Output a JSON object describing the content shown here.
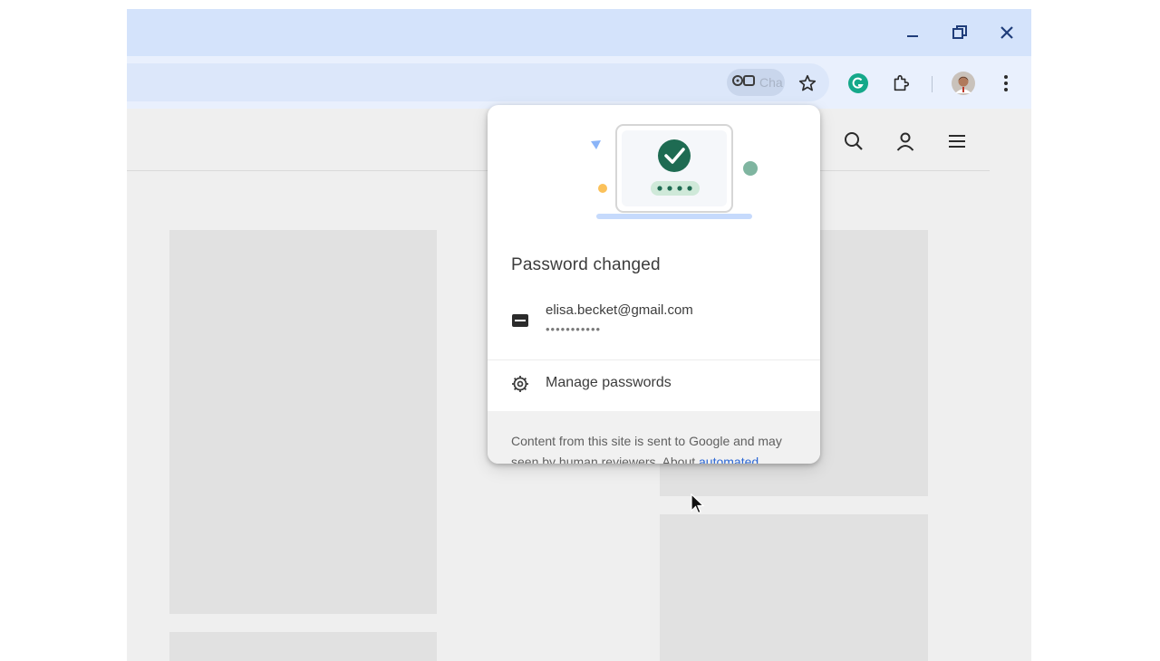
{
  "window": {
    "titlebar_color": "#d4e3fb",
    "controls": [
      {
        "name": "minimize-icon"
      },
      {
        "name": "restore-icon"
      },
      {
        "name": "close-icon"
      }
    ]
  },
  "toolbar": {
    "password_chip": {
      "icon": "key-icon",
      "label": "Cha"
    },
    "icons": [
      "bookmark-star-icon",
      "grammarly-extension-icon",
      "extensions-puzzle-icon",
      "profile-avatar",
      "more-menu-icon"
    ]
  },
  "site_header": {
    "icons": [
      "search-icon",
      "account-icon",
      "menu-icon"
    ]
  },
  "popup": {
    "title": "Password changed",
    "credential": {
      "email": "elisa.becket@gmail.com",
      "password_mask": "•••••••••••"
    },
    "manage_label": "Manage passwords",
    "footer_text": "Content from this site is sent to Google and may",
    "footer_text_line2": "seen by human reviewers. About",
    "footer_link": "automated",
    "accent_color": "#1e6b52"
  }
}
